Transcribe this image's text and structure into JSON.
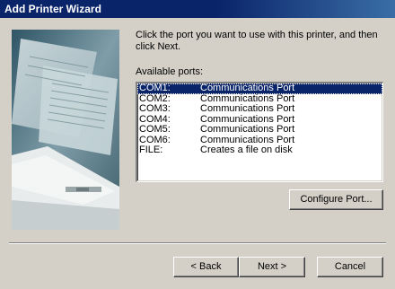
{
  "window": {
    "title": "Add Printer Wizard"
  },
  "prompt": "Click the port you want to use with this printer, and then click Next.",
  "available_label": "Available ports:",
  "ports": [
    {
      "port": "COM1:",
      "desc": "Communications Port",
      "selected": true
    },
    {
      "port": "COM2:",
      "desc": "Communications Port",
      "selected": false
    },
    {
      "port": "COM3:",
      "desc": "Communications Port",
      "selected": false
    },
    {
      "port": "COM4:",
      "desc": "Communications Port",
      "selected": false
    },
    {
      "port": "COM5:",
      "desc": "Communications Port",
      "selected": false
    },
    {
      "port": "COM6:",
      "desc": "Communications Port",
      "selected": false
    },
    {
      "port": "FILE:",
      "desc": "Creates a file on disk",
      "selected": false
    }
  ],
  "buttons": {
    "configure": "Configure Port...",
    "back": "< Back",
    "next": "Next >",
    "cancel": "Cancel"
  },
  "colors": {
    "title_bar": "#0a246a",
    "face": "#d4d0c8",
    "selection": "#0a246a"
  },
  "icons": [
    "printer-illustration"
  ]
}
